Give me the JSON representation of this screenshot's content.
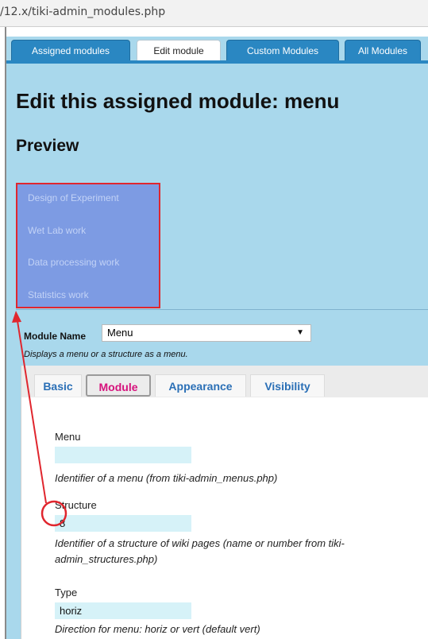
{
  "browser": {
    "url": "/12.x/tiki-admin_modules.php"
  },
  "tabs": [
    {
      "label": "Assigned modules",
      "active": false
    },
    {
      "label": "Edit module",
      "active": true
    },
    {
      "label": "Custom Modules",
      "active": false
    },
    {
      "label": "All Modules",
      "active": false
    }
  ],
  "page": {
    "title": "Edit this assigned module: menu",
    "preview_heading": "Preview"
  },
  "preview_menu": {
    "items": [
      "Design of Experiment",
      "Wet Lab work",
      "Data processing work",
      "Statistics work"
    ]
  },
  "module_name": {
    "label": "Module Name",
    "selected": "Menu",
    "description": "Displays a menu or a structure as a menu."
  },
  "subtabs": [
    {
      "label": "Basic",
      "active": false
    },
    {
      "label": "Module",
      "active": true
    },
    {
      "label": "Appearance",
      "active": false
    },
    {
      "label": "Visibility",
      "active": false
    }
  ],
  "fields": {
    "menu": {
      "label": "Menu",
      "value": "",
      "help": "Identifier of a menu (from tiki-admin_menus.php)"
    },
    "structure": {
      "label": "Structure",
      "value": "8",
      "help": "Identifier of a structure of wiki pages (name or number from tiki-admin_structures.php)"
    },
    "type": {
      "label": "Type",
      "value": "horiz",
      "help": "Direction for menu: horiz or vert (default vert)"
    }
  },
  "colors": {
    "tab_blue": "#2a87c2",
    "page_bg": "#a9d8ec",
    "preview_bg": "#7d9be3",
    "annotation_red": "#e0262e",
    "active_subtab": "#d6117c"
  }
}
